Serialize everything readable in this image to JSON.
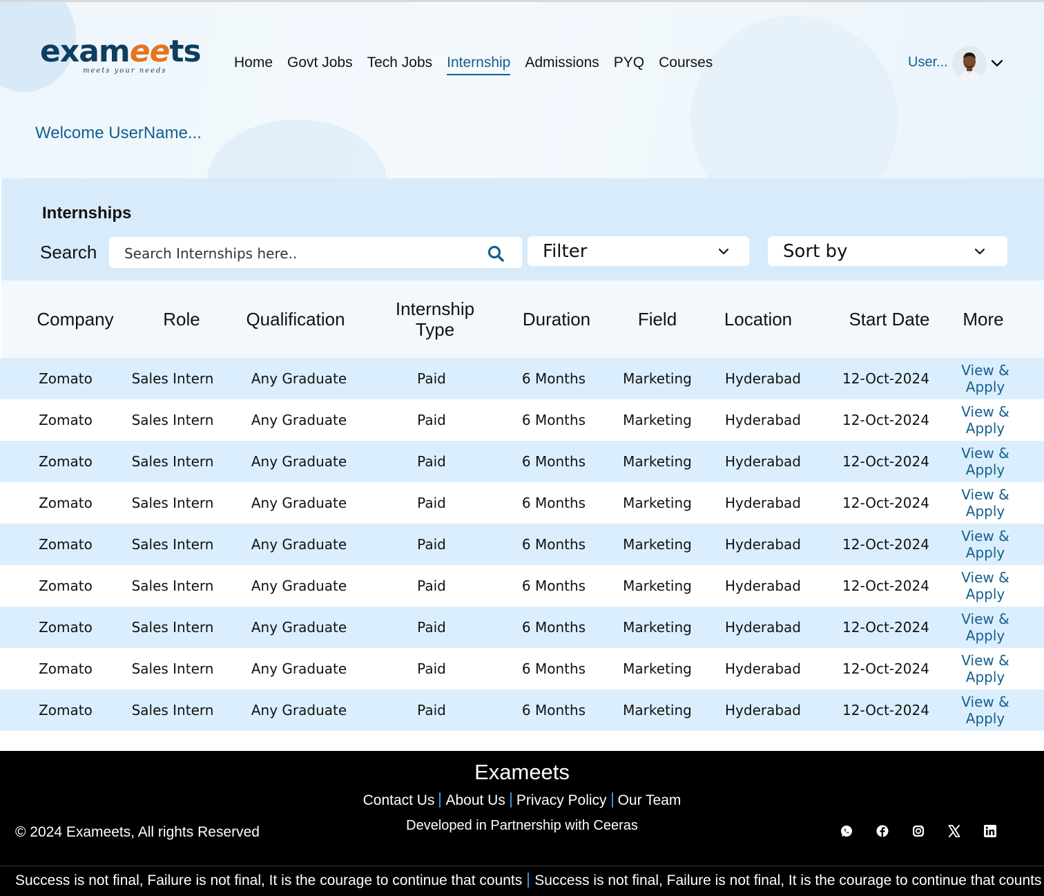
{
  "brand": {
    "logo_part1": "exam",
    "logo_part2": "ee",
    "logo_part3": "ts",
    "tagline": "meets your needs"
  },
  "nav": {
    "items": [
      {
        "label": "Home",
        "active": false
      },
      {
        "label": "Govt Jobs",
        "active": false
      },
      {
        "label": "Tech Jobs",
        "active": false
      },
      {
        "label": "Internship",
        "active": true
      },
      {
        "label": "Admissions",
        "active": false
      },
      {
        "label": "PYQ",
        "active": false
      },
      {
        "label": "Courses",
        "active": false
      }
    ],
    "user_label": "User..."
  },
  "welcome": "Welcome UserName...",
  "controls": {
    "title": "Internships",
    "search_label": "Search",
    "search_placeholder": "Search Internships here..",
    "filter_label": "Filter",
    "sort_label": "Sort by"
  },
  "table": {
    "headers": [
      "Company",
      "Role",
      "Qualification",
      "Internship Type",
      "Duration",
      "Field",
      "Location",
      "Start Date",
      "More"
    ],
    "action_label": "View & Apply",
    "rows": [
      [
        "Zomato",
        "Sales Intern",
        "Any Graduate",
        "Paid",
        "6 Months",
        "Marketing",
        "Hyderabad",
        "12-Oct-2024"
      ],
      [
        "Zomato",
        "Sales Intern",
        "Any Graduate",
        "Paid",
        "6 Months",
        "Marketing",
        "Hyderabad",
        "12-Oct-2024"
      ],
      [
        "Zomato",
        "Sales Intern",
        "Any Graduate",
        "Paid",
        "6 Months",
        "Marketing",
        "Hyderabad",
        "12-Oct-2024"
      ],
      [
        "Zomato",
        "Sales Intern",
        "Any Graduate",
        "Paid",
        "6 Months",
        "Marketing",
        "Hyderabad",
        "12-Oct-2024"
      ],
      [
        "Zomato",
        "Sales Intern",
        "Any Graduate",
        "Paid",
        "6 Months",
        "Marketing",
        "Hyderabad",
        "12-Oct-2024"
      ],
      [
        "Zomato",
        "Sales Intern",
        "Any Graduate",
        "Paid",
        "6 Months",
        "Marketing",
        "Hyderabad",
        "12-Oct-2024"
      ],
      [
        "Zomato",
        "Sales Intern",
        "Any Graduate",
        "Paid",
        "6 Months",
        "Marketing",
        "Hyderabad",
        "12-Oct-2024"
      ],
      [
        "Zomato",
        "Sales Intern",
        "Any Graduate",
        "Paid",
        "6 Months",
        "Marketing",
        "Hyderabad",
        "12-Oct-2024"
      ],
      [
        "Zomato",
        "Sales Intern",
        "Any Graduate",
        "Paid",
        "6 Months",
        "Marketing",
        "Hyderabad",
        "12-Oct-2024"
      ]
    ]
  },
  "footer": {
    "brand": "Exameets",
    "links": [
      "Contact Us",
      "About Us",
      "Privacy Policy",
      "Our Team"
    ],
    "developed": "Developed in Partnership with Ceeras",
    "copyright": "© 2024 Exameets, All rights Reserved",
    "socials": [
      "whatsapp-icon",
      "facebook-icon",
      "instagram-icon",
      "x-icon",
      "linkedin-icon"
    ],
    "ticker": "Success is not final, Failure is not final, It is the courage to continue that counts"
  },
  "colors": {
    "accent": "#125f8d",
    "logo_orange": "#e8731a",
    "row_band": "#dbeefd",
    "controls_band": "#d8ebfb"
  }
}
